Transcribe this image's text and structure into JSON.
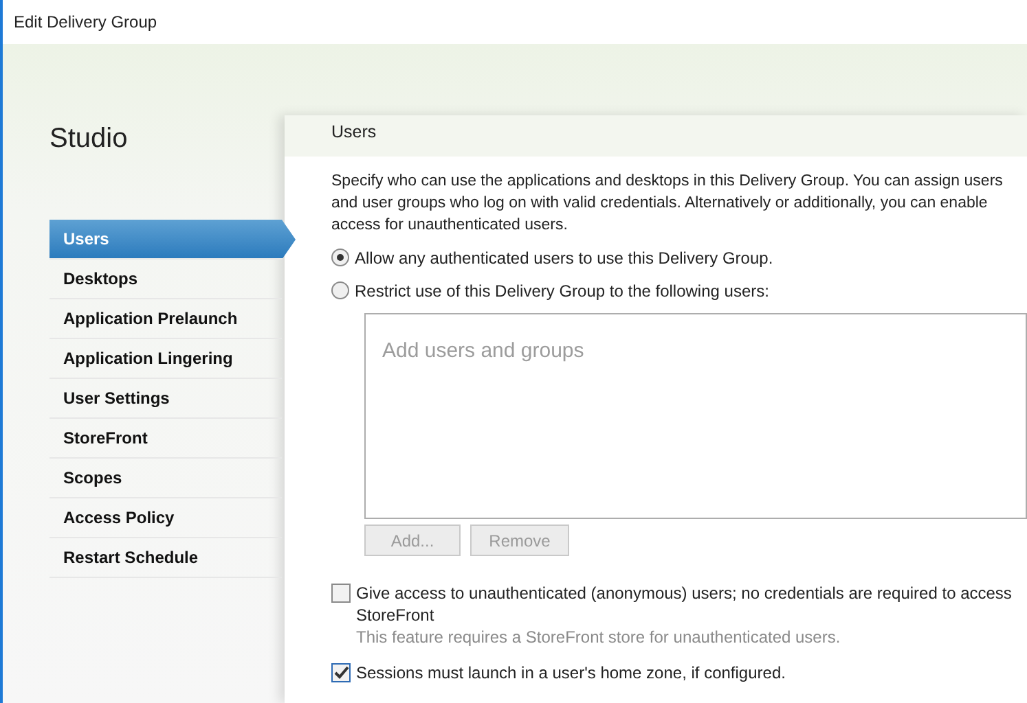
{
  "window": {
    "title": "Edit Delivery Group"
  },
  "sidebar": {
    "title": "Studio",
    "items": [
      {
        "label": "Users",
        "selected": true
      },
      {
        "label": "Desktops",
        "selected": false
      },
      {
        "label": "Application Prelaunch",
        "selected": false
      },
      {
        "label": "Application Lingering",
        "selected": false
      },
      {
        "label": "User Settings",
        "selected": false
      },
      {
        "label": "StoreFront",
        "selected": false
      },
      {
        "label": "Scopes",
        "selected": false
      },
      {
        "label": "Access Policy",
        "selected": false
      },
      {
        "label": "Restart Schedule",
        "selected": false
      }
    ]
  },
  "page": {
    "heading": "Users",
    "description": "Specify who can use the applications and desktops in this Delivery Group. You can assign users and user groups who log on with valid credentials. Alternatively or additionally, you can enable access for unauthenticated users.",
    "radios": [
      {
        "label": "Allow any authenticated users to use this Delivery Group.",
        "selected": true
      },
      {
        "label": "Restrict use of this Delivery Group to the following users:",
        "selected": false
      }
    ],
    "user_list": {
      "placeholder": "Add users and groups"
    },
    "buttons": [
      {
        "label": "Add...",
        "disabled": true
      },
      {
        "label": "Remove",
        "disabled": true
      }
    ],
    "checkboxes": [
      {
        "label": "Give access to unauthenticated (anonymous) users; no credentials are required to access StoreFront",
        "checked": false,
        "note": "This feature requires a StoreFront store for unauthenticated users."
      },
      {
        "label": "Sessions must launch in a user's home zone, if configured.",
        "checked": true
      }
    ]
  }
}
